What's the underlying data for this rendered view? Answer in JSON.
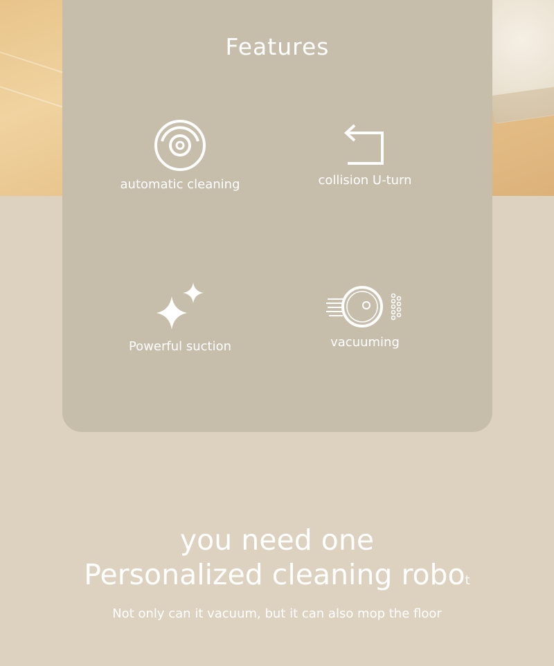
{
  "features_title": "Features",
  "features": [
    {
      "label": "automatic cleaning",
      "icon": "robot-vacuum-icon"
    },
    {
      "label": "collision U-turn",
      "icon": "u-turn-arrow-icon"
    },
    {
      "label": "Powerful suction",
      "icon": "sparkle-icon"
    },
    {
      "label": "vacuuming",
      "icon": "vacuum-dust-icon"
    }
  ],
  "headline_line1": "you need one",
  "headline_line2_main": "Personalized cleaning robo",
  "headline_line2_tail": "t",
  "subtitle": "Not only can it vacuum, but it can also mop the floor",
  "colors": {
    "card": "#c6bdab",
    "page_bg": "#dcd2bf",
    "text": "#ffffff"
  }
}
